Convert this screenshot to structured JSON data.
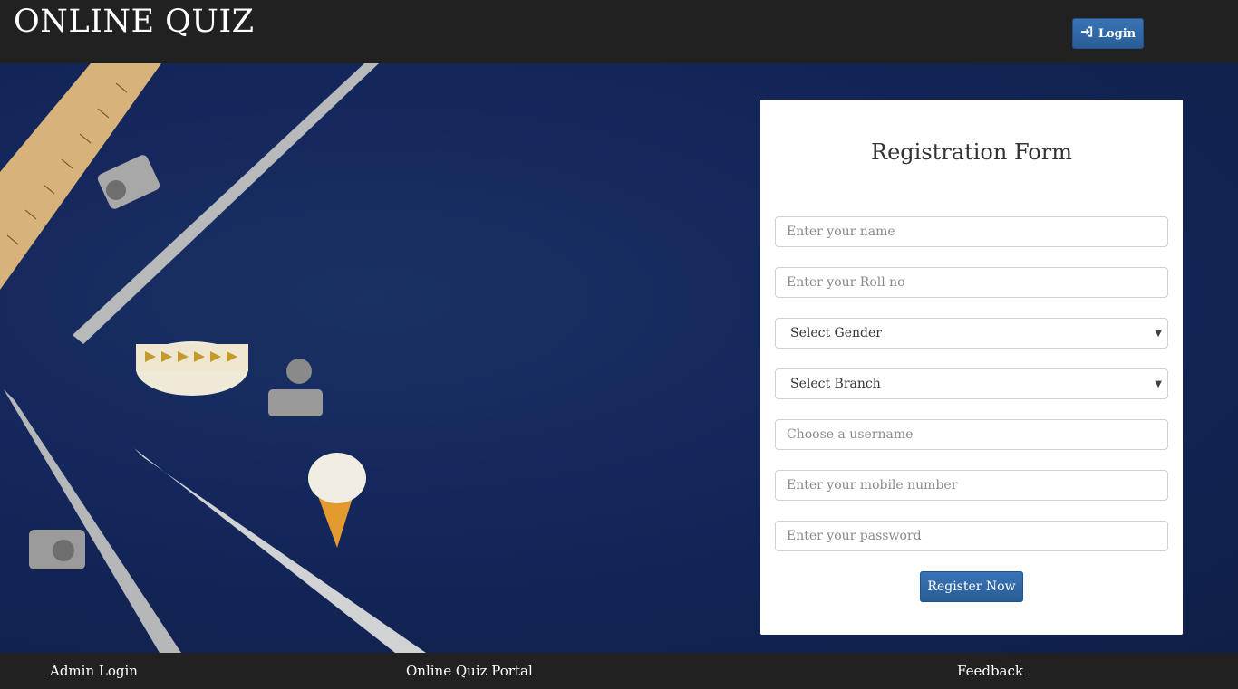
{
  "header": {
    "brand": "ONLINE QUIZ",
    "login_label": "Login"
  },
  "form": {
    "title": "Registration Form",
    "name_placeholder": "Enter your name",
    "roll_placeholder": "Enter your Roll no",
    "gender_selected": "Select Gender",
    "branch_selected": "Select Branch",
    "username_placeholder": "Choose a username",
    "mobile_placeholder": "Enter your mobile number",
    "password_placeholder": "Enter your password",
    "submit_label": "Register Now"
  },
  "footer": {
    "admin_login": "Admin Login",
    "portal": "Online Quiz Portal",
    "feedback": "Feedback"
  },
  "colors": {
    "bar": "#212121",
    "accent": "#2f67a6",
    "background": "#13254a"
  }
}
